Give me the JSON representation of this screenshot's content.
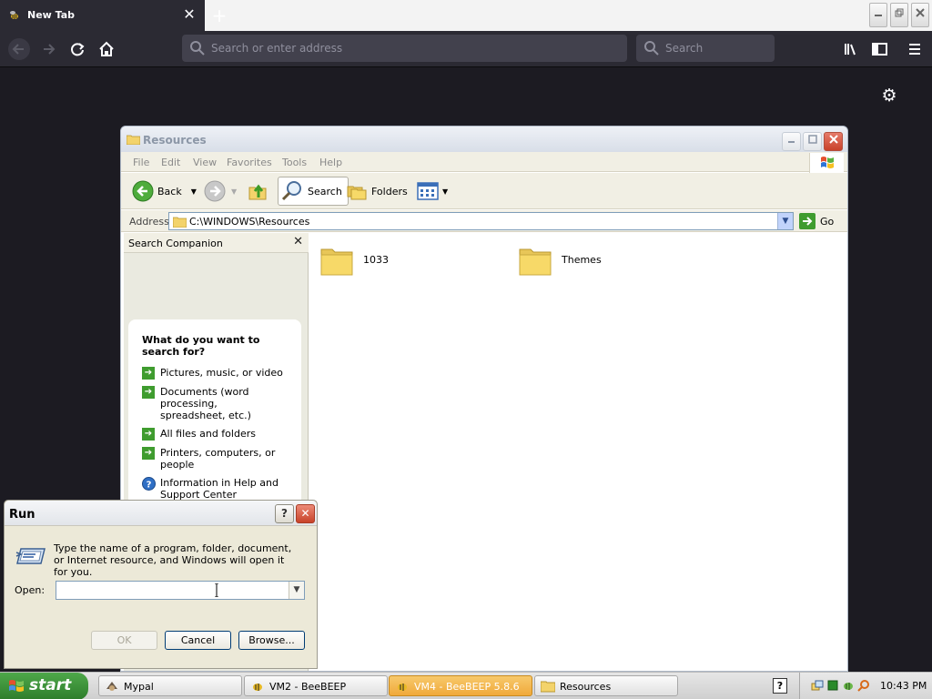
{
  "browser": {
    "tab_title": "New Tab",
    "close_symbol": "✕",
    "new_tab_symbol": "+",
    "url_placeholder": "Search or enter address",
    "search_placeholder": "Search",
    "icons": [
      "back-icon",
      "forward-icon",
      "reload-icon",
      "home-icon",
      "library-icon",
      "sidebar-icon",
      "menu-icon",
      "settings-gear-icon"
    ]
  },
  "explorer": {
    "title": "Resources",
    "menu": [
      "File",
      "Edit",
      "View",
      "Favorites",
      "Tools",
      "Help"
    ],
    "toolbar": {
      "back_label": "Back",
      "search_label": "Search",
      "folders_label": "Folders"
    },
    "address_label": "Address",
    "address_value": "C:\\WINDOWS\\Resources",
    "go_label": "Go",
    "search_companion": {
      "title": "Search Companion",
      "close_symbol": "✕",
      "question": "What do you want to search for?",
      "options": [
        "Pictures, music, or video",
        "Documents (word processing, spreadsheet, etc.)",
        "All files and folders",
        "Printers, computers, or people",
        "Information in Help and Support Center"
      ]
    },
    "files": [
      {
        "name": "1033"
      },
      {
        "name": "Themes"
      }
    ]
  },
  "run_dialog": {
    "title": "Run",
    "help_symbol": "?",
    "close_symbol": "✕",
    "description": "Type the name of a program, folder, document, or Internet resource, and Windows will open it for you.",
    "open_label": "Open:",
    "open_value": "",
    "ok_label": "OK",
    "cancel_label": "Cancel",
    "browse_label": "Browse..."
  },
  "taskbar": {
    "start_label": "start",
    "tasks": [
      {
        "label": "Mypal",
        "active": false
      },
      {
        "label": "VM2 - BeeBEEP",
        "active": false
      },
      {
        "label": "VM4 - BeeBEEP 5.8.6",
        "active": true
      },
      {
        "label": "Resources",
        "active": false
      }
    ],
    "help_symbol": "?",
    "clock": "10:43 PM"
  },
  "colors": {
    "firefox_dark": "#2b2a33",
    "xp_start_green": "#3c9a3a",
    "active_task_orange": "#f0a93a",
    "folder_yellow": "#f7d968"
  }
}
